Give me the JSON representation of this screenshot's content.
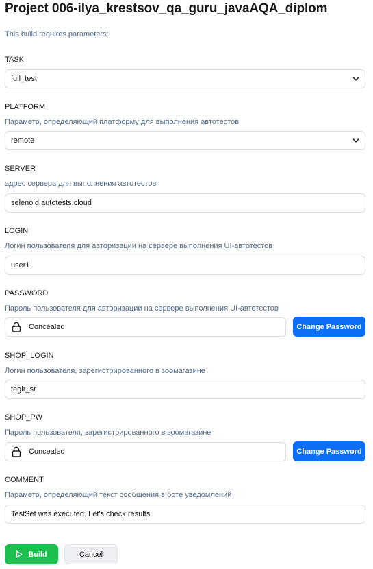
{
  "page": {
    "title": "Project 006-ilya_krestsov_qa_guru_javaAQA_diplom",
    "subtitle": "This build requires parameters:"
  },
  "params": {
    "task": {
      "name": "TASK",
      "value": "full_test"
    },
    "platform": {
      "name": "PLATFORM",
      "description": "Параметр, определяющий платформу для выполнения автотестов",
      "value": "remote"
    },
    "server": {
      "name": "SERVER",
      "description": "адрес сервера для выполнения  автотестов",
      "value": "selenoid.autotests.cloud"
    },
    "login": {
      "name": "LOGIN",
      "description": "Логин пользователя для авторизации на сервере выполнения UI-автотестов",
      "value": "user1"
    },
    "password": {
      "name": "PASSWORD",
      "description": "Пароль пользователя для авторизации на сервере выполнения UI-автотестов",
      "value": "Concealed",
      "button": "Change Password"
    },
    "shop_login": {
      "name": "SHOP_LOGIN",
      "description": "Логин пользователя, зарегистрированного в зоомагазине",
      "value": "tegir_st"
    },
    "shop_pw": {
      "name": "SHOP_PW",
      "description": "Пароль пользователя, зарегистрированного в зоомагазине",
      "value": "Concealed",
      "button": "Change Password"
    },
    "comment": {
      "name": "COMMENT",
      "description": "Параметр, определяющий текст сообщения в боте уведомлений",
      "value": "TestSet was executed. Let's check results"
    }
  },
  "actions": {
    "build": "Build",
    "cancel": "Cancel"
  },
  "colors": {
    "primary": "#0b6ef5",
    "build": "#1dbf4f",
    "description": "#4f6a8a"
  },
  "icons": {
    "select": "chevron-down-icon",
    "password": "lock-icon",
    "build": "play-icon"
  }
}
